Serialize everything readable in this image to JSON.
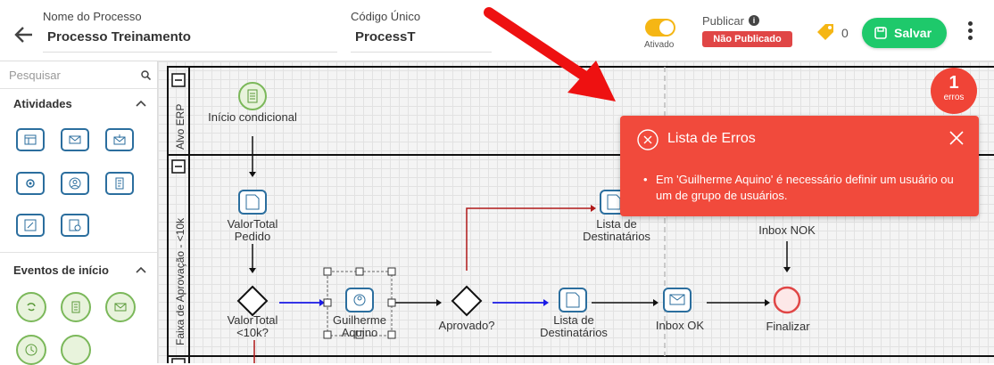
{
  "header": {
    "process_name_label": "Nome do Processo",
    "process_name_value": "Processo Treinamento",
    "code_label": "Código Único",
    "code_value": "ProcessT",
    "toggle_label": "Ativado",
    "publish_label": "Publicar",
    "publish_status": "Não Publicado",
    "tag_count": "0",
    "save_label": "Salvar"
  },
  "sidebar": {
    "search_placeholder": "Pesquisar",
    "sections": [
      {
        "title": "Atividades"
      },
      {
        "title": "Eventos de início"
      }
    ]
  },
  "canvas": {
    "lanes": [
      {
        "label": "Alvo ERP"
      },
      {
        "label": "Faixa de Aprovação - <10k"
      }
    ],
    "nodes": {
      "start": "Início condicional",
      "valor_total_pedido": "ValorTotal Pedido",
      "gateway1": "ValorTotal <10k?",
      "guilherme": "Guilherme Aquino",
      "aprovado": "Aprovado?",
      "lista1": "Lista de Destinatários",
      "lista2": "Lista de Destinatários",
      "inbox_ok": "Inbox OK",
      "inbox_nok": "Inbox NOK",
      "finalizar": "Finalizar"
    }
  },
  "errors": {
    "count": "1",
    "count_label": "erros",
    "panel_title": "Lista de Erros",
    "items": [
      "Em 'Guilherme Aquino' é necessário definir um usuário ou um de grupo de usuários."
    ]
  },
  "colors": {
    "accent_green": "#1ec96b",
    "error_red": "#f14a3c",
    "task_blue": "#2b6e9e",
    "toggle_yellow": "#f5b614"
  }
}
